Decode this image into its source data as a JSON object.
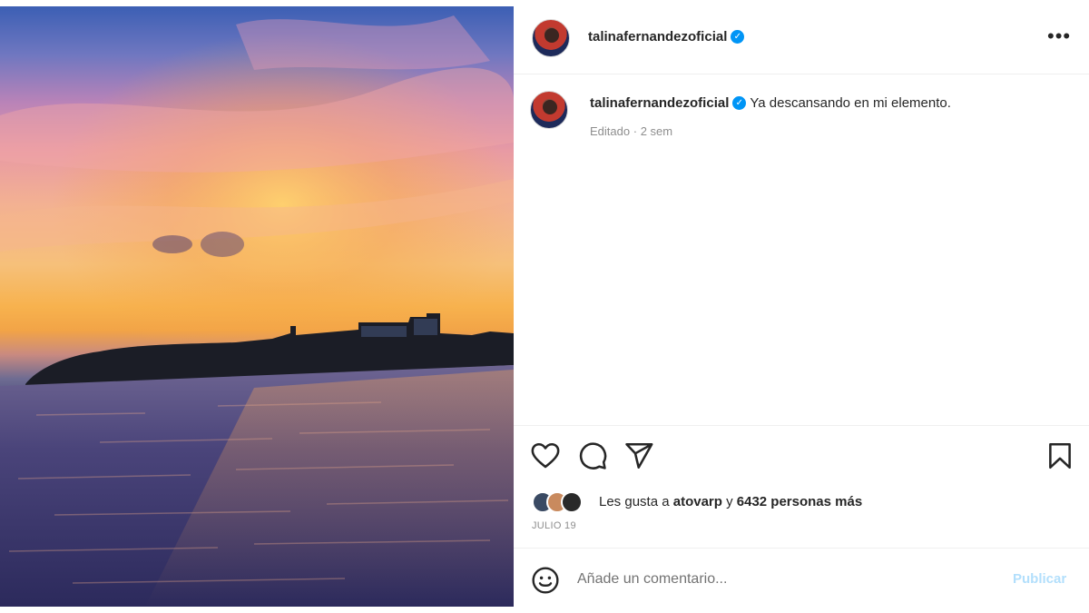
{
  "post": {
    "username": "talinafernandezoficial",
    "verified": true,
    "caption_text": "Ya descansando en mi elemento.",
    "edited_label": "Editado",
    "time_ago": "2 sem",
    "meta_separator": "·",
    "likes_prefix": "Les gusta a",
    "likes_user": "atovarp",
    "likes_conjunction": "y",
    "likes_count_text": "6432 personas más",
    "date": "JULIO 19"
  },
  "actions": {
    "like_icon": "heart-icon",
    "comment_icon": "comment-icon",
    "share_icon": "send-icon",
    "save_icon": "bookmark-icon",
    "more_icon": "more-options-icon"
  },
  "comment": {
    "emoji_icon": "emoji-icon",
    "placeholder": "Añade un comentario...",
    "publish_label": "Publicar"
  },
  "colors": {
    "verified_blue": "#0095f6",
    "publish_disabled": "#b2dffc",
    "meta_gray": "#8e8e8e"
  }
}
